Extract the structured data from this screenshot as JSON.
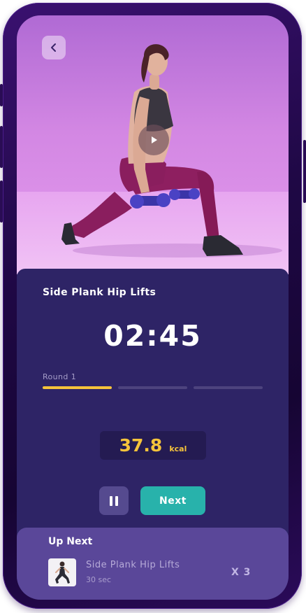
{
  "workout": {
    "title": "Side Plank Hip Lifts",
    "timer": "02:45",
    "round_label": "Round 1",
    "progress_segments": 3,
    "progress_active": 1,
    "calories_value": "37.8",
    "calories_unit": "kcal",
    "next_label": "Next"
  },
  "up_next": {
    "heading": "Up Next",
    "name": "Side Plank Hip Lifts",
    "duration": "30 sec",
    "reps": "X 3"
  },
  "icons": {
    "back": "chevron-left-icon",
    "play": "play-icon",
    "pause": "pause-icon"
  },
  "colors": {
    "panel": "#2e2466",
    "accent_yellow": "#f5c33b",
    "accent_teal": "#28b2ab",
    "upnext_card": "#5a4799"
  }
}
